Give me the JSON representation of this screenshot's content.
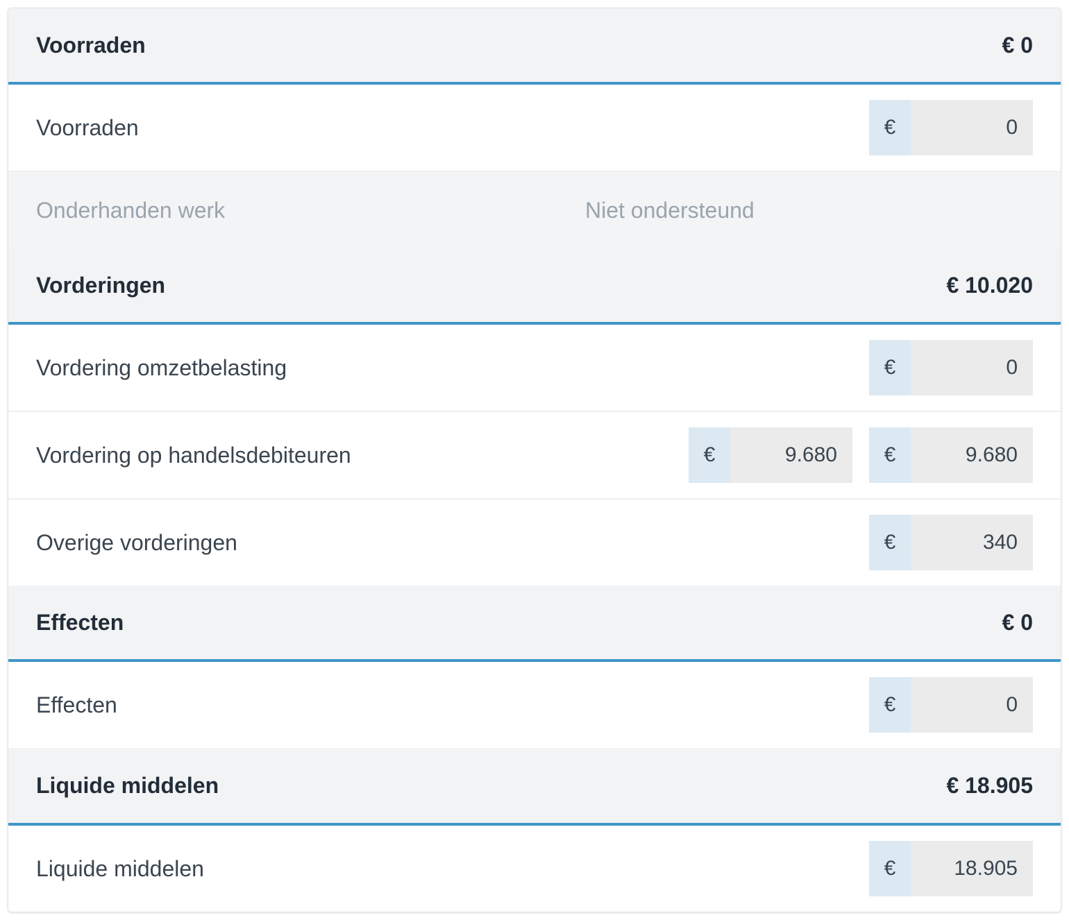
{
  "sections": [
    {
      "title": "Voorraden",
      "total": "€ 0",
      "rows": [
        {
          "label": "Voorraden",
          "values": [
            "0"
          ]
        },
        {
          "label": "Onderhanden werk",
          "disabled": true,
          "note": "Niet ondersteund"
        }
      ]
    },
    {
      "title": "Vorderingen",
      "total": "€ 10.020",
      "rows": [
        {
          "label": "Vordering omzetbelasting",
          "values": [
            "0"
          ]
        },
        {
          "label": "Vordering op handelsdebiteuren",
          "values": [
            "9.680",
            "9.680"
          ]
        },
        {
          "label": "Overige vorderingen",
          "values": [
            "340"
          ]
        }
      ]
    },
    {
      "title": "Effecten",
      "total": "€ 0",
      "rows": [
        {
          "label": "Effecten",
          "values": [
            "0"
          ]
        }
      ]
    },
    {
      "title": "Liquide middelen",
      "total": "€ 18.905",
      "rows": [
        {
          "label": "Liquide middelen",
          "values": [
            "18.905"
          ]
        }
      ]
    }
  ],
  "currency_symbol": "€",
  "colors": {
    "accent": "#3e96c8",
    "header_bg": "#f2f3f5",
    "currency_bg": "#dce9f2",
    "input_bg": "#ebebeb",
    "disabled_text": "#9aa4ad"
  }
}
